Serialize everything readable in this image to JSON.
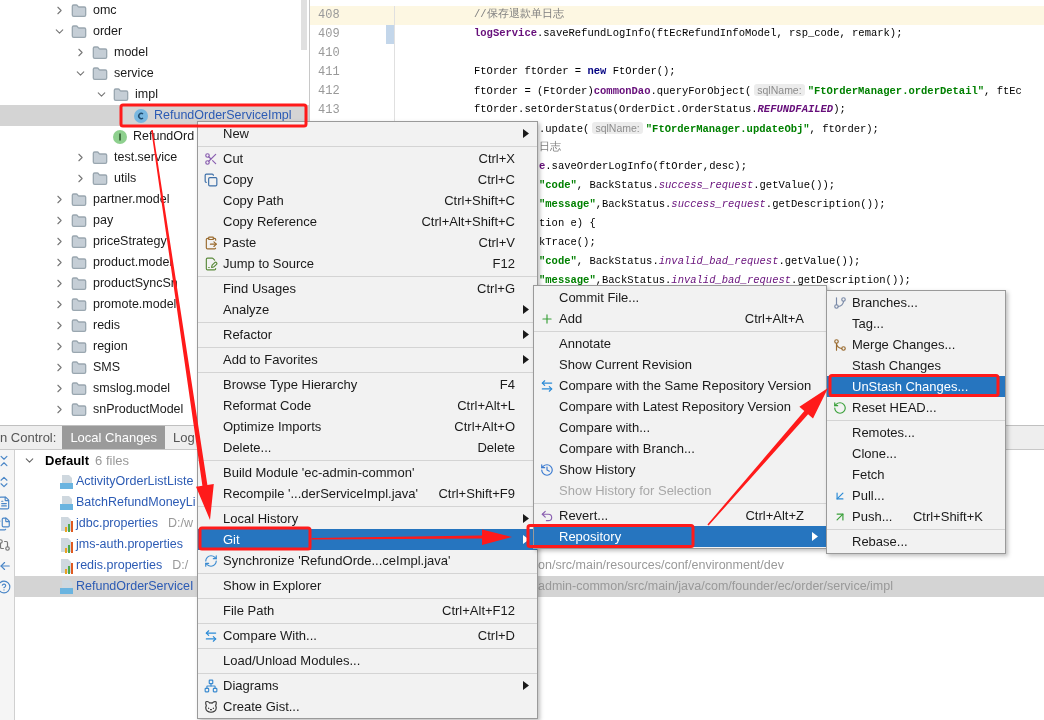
{
  "project_tree": {
    "items": [
      {
        "label": "omc",
        "kind": "folder",
        "expanded": false,
        "selected": false,
        "modified": false
      },
      {
        "label": "order",
        "kind": "folder",
        "expanded": true,
        "selected": false,
        "modified": false,
        "children": [
          {
            "label": "model",
            "kind": "folder",
            "expanded": false,
            "selected": false,
            "modified": false
          },
          {
            "label": "service",
            "kind": "folder",
            "expanded": true,
            "selected": false,
            "modified": false,
            "children": [
              {
                "label": "impl",
                "kind": "folder",
                "expanded": true,
                "selected": false,
                "modified": false,
                "children": [
                  {
                    "label": "RefundOrderServiceImpl",
                    "kind": "class",
                    "selected": true,
                    "modified": true
                  }
                ]
              },
              {
                "label": "RefundOrd",
                "kind": "interface",
                "selected": false,
                "modified": false
              }
            ]
          },
          {
            "label": "test.service",
            "kind": "folder",
            "expanded": false,
            "selected": false,
            "modified": false
          },
          {
            "label": "utils",
            "kind": "folder",
            "expanded": false,
            "selected": false,
            "modified": false
          }
        ]
      },
      {
        "label": "partner.model",
        "kind": "folder",
        "expanded": false,
        "selected": false,
        "modified": false
      },
      {
        "label": "pay",
        "kind": "folder",
        "expanded": false,
        "selected": false,
        "modified": false
      },
      {
        "label": "priceStrategy",
        "kind": "folder",
        "expanded": false,
        "selected": false,
        "modified": false
      },
      {
        "label": "product.model",
        "kind": "folder",
        "expanded": false,
        "selected": false,
        "modified": false
      },
      {
        "label": "productSyncSn",
        "kind": "folder",
        "expanded": false,
        "selected": false,
        "modified": false
      },
      {
        "label": "promote.model",
        "kind": "folder",
        "expanded": false,
        "selected": false,
        "modified": false
      },
      {
        "label": "redis",
        "kind": "folder",
        "expanded": false,
        "selected": false,
        "modified": false
      },
      {
        "label": "region",
        "kind": "folder",
        "expanded": false,
        "selected": false,
        "modified": false
      },
      {
        "label": "SMS",
        "kind": "folder",
        "expanded": false,
        "selected": false,
        "modified": false
      },
      {
        "label": "smslog.model",
        "kind": "folder",
        "expanded": false,
        "selected": false,
        "modified": false
      },
      {
        "label": "snProductModel",
        "kind": "folder",
        "expanded": false,
        "selected": false,
        "modified": false
      }
    ]
  },
  "editor": {
    "lines": [
      {
        "number": "408",
        "current": true,
        "changed": false,
        "tokens": [
          {
            "kind": "comment",
            "t": "//保存退款单日志"
          }
        ]
      },
      {
        "number": "409",
        "current": false,
        "changed": true,
        "tokens": [
          {
            "kind": "field",
            "t": "logService"
          },
          {
            "kind": "plain",
            "t": ".saveRefundLogInfo(ftEcRefundInfoModel, rsp_code, remark);"
          }
        ]
      },
      {
        "number": "410",
        "current": false,
        "changed": false
      },
      {
        "number": "411",
        "current": false,
        "changed": false,
        "tokens": [
          {
            "kind": "plain",
            "t": "FtOrder ftOrder = "
          },
          {
            "kind": "keyword",
            "t": "new"
          },
          {
            "kind": "plain",
            "t": " FtOrder();"
          }
        ]
      },
      {
        "number": "412",
        "current": false,
        "changed": false,
        "tokens": [
          {
            "kind": "plain",
            "t": "ftOrder = (FtOrder)"
          },
          {
            "kind": "field",
            "t": "commonDao"
          },
          {
            "kind": "plain",
            "t": ".queryForObject("
          },
          {
            "kind": "hint",
            "t": "sqlName:"
          },
          {
            "kind": "string",
            "t": "\"FtOrderManager.orderDetail\""
          },
          {
            "kind": "plain",
            "t": ", ftEc"
          }
        ]
      },
      {
        "number": "413",
        "current": false,
        "changed": false,
        "tokens": [
          {
            "kind": "plain",
            "t": "ftOrder.setOrderStatus(OrderDict.OrderStatus."
          },
          {
            "kind": "constant",
            "t": "REFUNDFAILED"
          },
          {
            "kind": "plain",
            "t": ");"
          }
        ]
      },
      {
        "current": false,
        "tokens": [
          {
            "kind": "plain",
            "t": ".update("
          },
          {
            "kind": "hint",
            "t": "sqlName:"
          },
          {
            "kind": "string",
            "t": "\"FtOrderManager.updateObj\""
          },
          {
            "kind": "plain",
            "t": ", ftOrder);"
          }
        ]
      },
      {
        "current": false,
        "tokens": [
          {
            "kind": "comment",
            "t": "日志"
          }
        ]
      },
      {
        "current": false,
        "tokens": [
          {
            "kind": "field",
            "t": "e"
          },
          {
            "kind": "plain",
            "t": ".saveOrderLogInfo(ftOrder,desc);"
          }
        ]
      },
      {
        "current": false,
        "tokens": [
          {
            "kind": "string",
            "t": "\"code\""
          },
          {
            "kind": "plain",
            "t": ", BackStatus."
          },
          {
            "kind": "static",
            "t": "success_request"
          },
          {
            "kind": "plain",
            "t": ".getValue());"
          }
        ]
      },
      {
        "current": false,
        "tokens": [
          {
            "kind": "string",
            "t": "\"message\""
          },
          {
            "kind": "plain",
            "t": ",BackStatus."
          },
          {
            "kind": "static",
            "t": "success_request"
          },
          {
            "kind": "plain",
            "t": ".getDescription());"
          }
        ]
      },
      {
        "current": false,
        "tokens": [
          {
            "kind": "plain",
            "t": "tion e) {"
          }
        ]
      },
      {
        "current": false,
        "tokens": [
          {
            "kind": "plain",
            "t": "kTrace();"
          }
        ]
      },
      {
        "current": false,
        "tokens": [
          {
            "kind": "string",
            "t": "\"code\""
          },
          {
            "kind": "plain",
            "t": ", BackStatus."
          },
          {
            "kind": "static",
            "t": "invalid_bad_request"
          },
          {
            "kind": "plain",
            "t": ".getValue());"
          }
        ]
      },
      {
        "current": false,
        "tokens": [
          {
            "kind": "string",
            "t": "\"message\""
          },
          {
            "kind": "plain",
            "t": ",BackStatus."
          },
          {
            "kind": "static",
            "t": "invalid_bad_request"
          },
          {
            "kind": "plain",
            "t": ".getDescription());"
          }
        ]
      }
    ]
  },
  "version_control": {
    "label": "n Control:",
    "tabs": [
      {
        "label": "Local Changes",
        "selected": true
      },
      {
        "label": "Log",
        "selected": false
      }
    ],
    "changelist": {
      "name": "Default",
      "count": "6 files",
      "expanded": true,
      "files": [
        {
          "name": "ActivityOrderListListe",
          "kind": "java",
          "selected": false
        },
        {
          "name": "BatchRefundMoneyLi",
          "kind": "java",
          "selected": false
        },
        {
          "name": "jdbc.properties",
          "path": "D:/w",
          "kind": "properties",
          "selected": false
        },
        {
          "name": "jms-auth.properties",
          "kind": "properties",
          "selected": false
        },
        {
          "name": "redis.properties",
          "path": "D:/",
          "path_tail": "on/src/main/resources/conf/environment/dev",
          "kind": "properties",
          "selected": false
        },
        {
          "name": "RefundOrderServiceI",
          "path_tail": "admin-common/src/main/java/com/founder/ec/order/service/impl",
          "kind": "java",
          "selected": true
        }
      ]
    }
  },
  "context_menu": {
    "groups": [
      [
        {
          "label": "New",
          "submenu": true,
          "selected": false,
          "disabled": false
        }
      ],
      [
        {
          "label": "Cut",
          "shortcut": "Ctrl+X",
          "submenu": false,
          "selected": false,
          "disabled": false
        },
        {
          "label": "Copy",
          "shortcut": "Ctrl+C",
          "submenu": false,
          "selected": false,
          "disabled": false
        },
        {
          "label": "Copy Path",
          "shortcut": "Ctrl+Shift+C",
          "submenu": false,
          "selected": false,
          "disabled": false
        },
        {
          "label": "Copy Reference",
          "shortcut": "Ctrl+Alt+Shift+C",
          "submenu": false,
          "selected": false,
          "disabled": false
        },
        {
          "label": "Paste",
          "shortcut": "Ctrl+V",
          "submenu": false,
          "selected": false,
          "disabled": false
        },
        {
          "label": "Jump to Source",
          "shortcut": "F12",
          "submenu": false,
          "selected": false,
          "disabled": false
        }
      ],
      [
        {
          "label": "Find Usages",
          "shortcut": "Ctrl+G",
          "submenu": false,
          "selected": false,
          "disabled": false
        },
        {
          "label": "Analyze",
          "submenu": true,
          "selected": false,
          "disabled": false
        }
      ],
      [
        {
          "label": "Refactor",
          "submenu": true,
          "selected": false,
          "disabled": false
        }
      ],
      [
        {
          "label": "Add to Favorites",
          "submenu": true,
          "selected": false,
          "disabled": false
        }
      ],
      [
        {
          "label": "Browse Type Hierarchy",
          "shortcut": "F4",
          "submenu": false,
          "selected": false,
          "disabled": false
        },
        {
          "label": "Reformat Code",
          "shortcut": "Ctrl+Alt+L",
          "submenu": false,
          "selected": false,
          "disabled": false
        },
        {
          "label": "Optimize Imports",
          "shortcut": "Ctrl+Alt+O",
          "submenu": false,
          "selected": false,
          "disabled": false
        },
        {
          "label": "Delete...",
          "shortcut": "Delete",
          "submenu": false,
          "selected": false,
          "disabled": false
        }
      ],
      [
        {
          "label": "Build Module 'ec-admin-common'",
          "submenu": false,
          "selected": false,
          "disabled": false
        },
        {
          "label": "Recompile '...derServiceImpl.java'",
          "shortcut": "Ctrl+Shift+F9",
          "submenu": false,
          "selected": false,
          "disabled": false
        }
      ],
      [
        {
          "label": "Local History",
          "submenu": true,
          "selected": false,
          "disabled": false
        },
        {
          "label": "Git",
          "submenu": true,
          "selected": true,
          "disabled": false
        },
        {
          "label": "Synchronize 'RefundOrde...ceImpl.java'",
          "submenu": false,
          "selected": false,
          "disabled": false
        }
      ],
      [
        {
          "label": "Show in Explorer",
          "submenu": false,
          "selected": false,
          "disabled": false
        }
      ],
      [
        {
          "label": "File Path",
          "shortcut": "Ctrl+Alt+F12",
          "submenu": false,
          "selected": false,
          "disabled": false
        }
      ],
      [
        {
          "label": "Compare With...",
          "shortcut": "Ctrl+D",
          "submenu": false,
          "selected": false,
          "disabled": false
        }
      ],
      [
        {
          "label": "Load/Unload Modules...",
          "submenu": false,
          "selected": false,
          "disabled": false
        }
      ],
      [
        {
          "label": "Diagrams",
          "submenu": true,
          "selected": false,
          "disabled": false
        },
        {
          "label": "Create Gist...",
          "submenu": false,
          "selected": false,
          "disabled": false
        }
      ]
    ]
  },
  "git_submenu": {
    "groups": [
      [
        {
          "label": "Commit File...",
          "submenu": false,
          "selected": false,
          "disabled": false
        },
        {
          "label": "Add",
          "shortcut": "Ctrl+Alt+A",
          "submenu": false,
          "selected": false,
          "disabled": false
        }
      ],
      [
        {
          "label": "Annotate",
          "submenu": false,
          "selected": false,
          "disabled": false
        },
        {
          "label": "Show Current Revision",
          "submenu": false,
          "selected": false,
          "disabled": false
        },
        {
          "label": "Compare with the Same Repository Version",
          "submenu": false,
          "selected": false,
          "disabled": false
        },
        {
          "label": "Compare with Latest Repository Version",
          "selected": false,
          "disabled": false
        },
        {
          "label": "Compare with...",
          "submenu": false,
          "selected": false,
          "disabled": false
        },
        {
          "label": "Compare with Branch...",
          "submenu": false,
          "selected": false,
          "disabled": false
        },
        {
          "label": "Show History",
          "submenu": false,
          "selected": false,
          "disabled": false
        },
        {
          "label": "Show History for Selection",
          "submenu": false,
          "selected": false,
          "disabled": true
        }
      ],
      [
        {
          "label": "Revert...",
          "shortcut": "Ctrl+Alt+Z",
          "submenu": false,
          "selected": false,
          "disabled": false
        },
        {
          "label": "Repository",
          "submenu": true,
          "selected": true,
          "disabled": false
        }
      ]
    ]
  },
  "repository_submenu": {
    "groups": [
      [
        {
          "label": "Branches...",
          "submenu": false,
          "selected": false,
          "disabled": false
        },
        {
          "label": "Tag...",
          "submenu": false,
          "selected": false,
          "disabled": false
        },
        {
          "label": "Merge Changes...",
          "submenu": false,
          "selected": false,
          "disabled": false
        },
        {
          "label": "Stash Changes",
          "submenu": false,
          "selected": false,
          "disabled": false
        },
        {
          "label": "UnStash Changes...",
          "submenu": false,
          "selected": true,
          "disabled": false
        },
        {
          "label": "Reset HEAD...",
          "submenu": false,
          "selected": false,
          "disabled": false
        }
      ],
      [
        {
          "label": "Remotes...",
          "submenu": false,
          "selected": false,
          "disabled": false
        },
        {
          "label": "Clone...",
          "submenu": false,
          "selected": false,
          "disabled": false
        },
        {
          "label": "Fetch",
          "submenu": false,
          "selected": false,
          "disabled": false
        },
        {
          "label": "Pull...",
          "submenu": false,
          "selected": false,
          "disabled": false
        },
        {
          "label": "Push...",
          "shortcut": "Ctrl+Shift+K",
          "submenu": false,
          "selected": false,
          "disabled": false
        }
      ],
      [
        {
          "label": "Rebase...",
          "submenu": false,
          "selected": false,
          "disabled": false
        }
      ]
    ]
  }
}
